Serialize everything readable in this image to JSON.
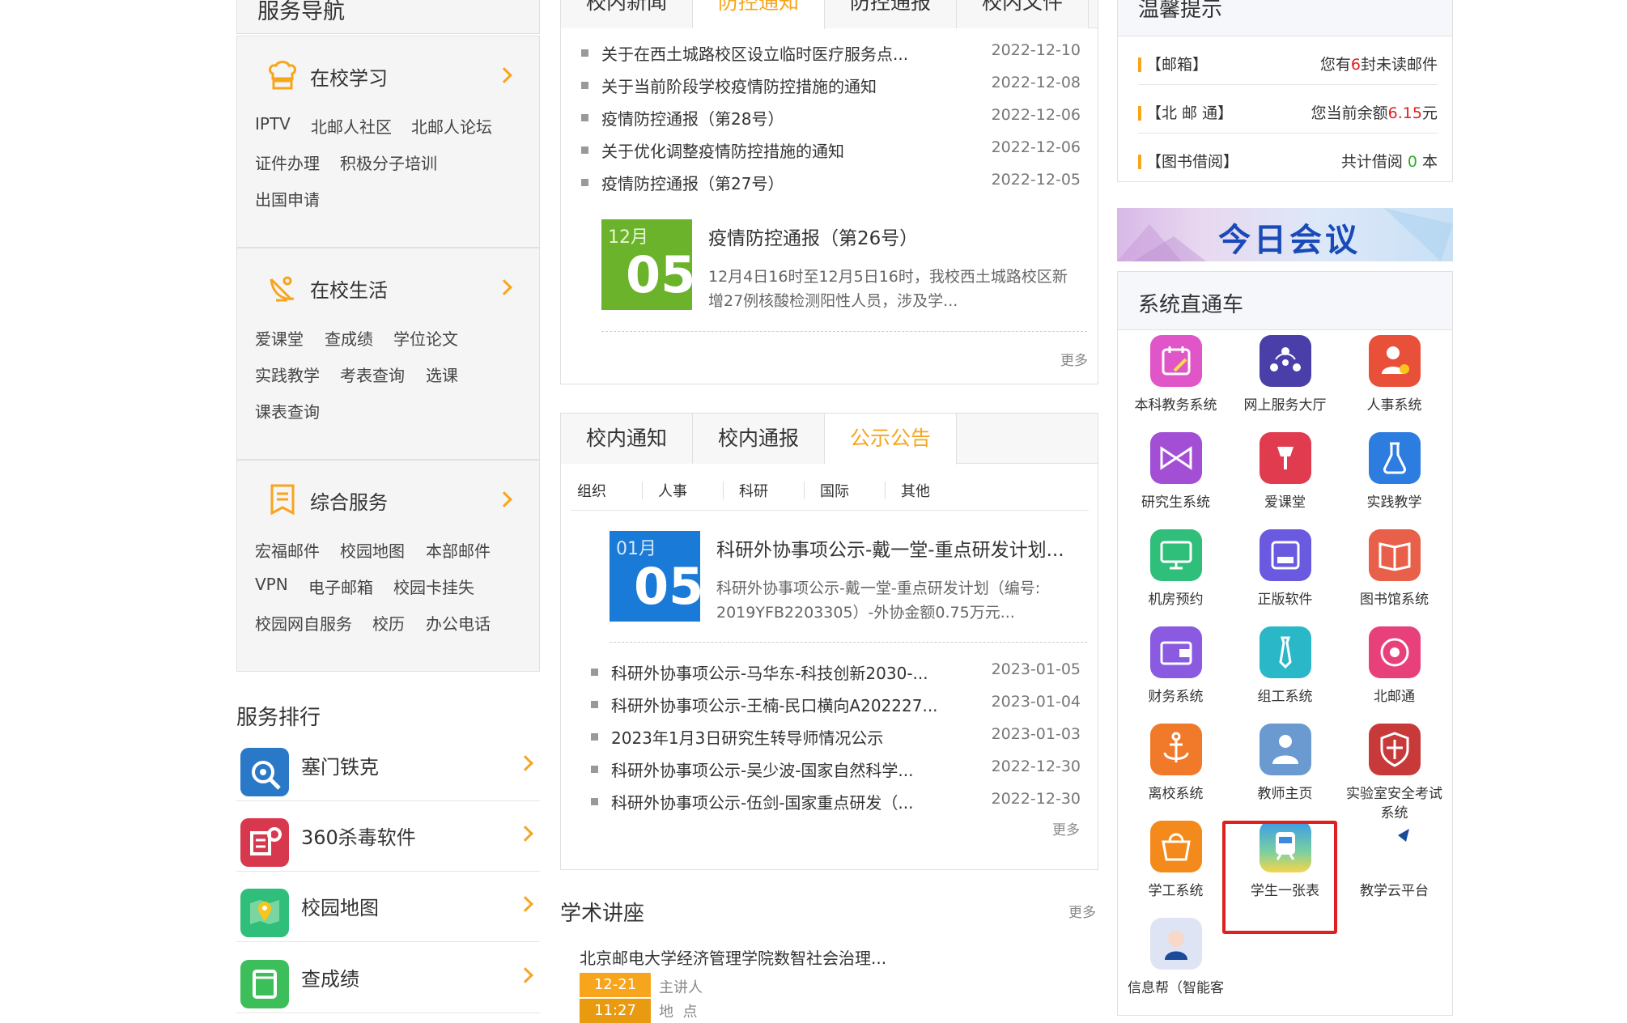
{
  "service_nav": {
    "title": "服务导航",
    "sections": [
      {
        "title": "在校学习",
        "links": [
          "IPTV",
          "北邮人社区",
          "北邮人论坛",
          "证件办理",
          "积极分子培训",
          "出国申请"
        ]
      },
      {
        "title": "在校生活",
        "links": [
          "爱课堂",
          "查成绩",
          "学位论文",
          "实践教学",
          "考表查询",
          "选课",
          "课表查询"
        ]
      },
      {
        "title": "综合服务",
        "links": [
          "宏福邮件",
          "校园地图",
          "本部邮件",
          "VPN",
          "电子邮箱",
          "校园卡挂失",
          "校园网自服务",
          "校历",
          "办公电话"
        ]
      }
    ]
  },
  "service_rank": {
    "title": "服务排行",
    "items": [
      "塞门铁克",
      "360杀毒软件",
      "校园地图",
      "查成绩"
    ]
  },
  "news_panel": {
    "tabs": [
      "校内新闻",
      "防控通知",
      "防控通报",
      "校内文件"
    ],
    "active_tab": 1,
    "items": [
      {
        "title": "关于在西土城路校区设立临时医疗服务点...",
        "date": "2022-12-10"
      },
      {
        "title": "关于当前阶段学校疫情防控措施的通知",
        "date": "2022-12-08"
      },
      {
        "title": "疫情防控通报（第28号）",
        "date": "2022-12-06"
      },
      {
        "title": "关于优化调整疫情防控措施的通知",
        "date": "2022-12-06"
      },
      {
        "title": "疫情防控通报（第27号）",
        "date": "2022-12-05"
      }
    ],
    "featured": {
      "month": "12月",
      "day": "05",
      "title": "疫情防控通报（第26号）",
      "summary_line1": "12月4日16时至12月5日16时，我校西土城路校区新",
      "summary_line2": "增27例核酸检测阳性人员，涉及学..."
    },
    "more": "更多"
  },
  "notice_panel": {
    "tabs": [
      "校内通知",
      "校内通报",
      "公示公告"
    ],
    "active_tab": 2,
    "subtabs": [
      "组织",
      "人事",
      "科研",
      "国际",
      "其他"
    ],
    "featured": {
      "month": "01月",
      "day": "05",
      "title": "科研外协事项公示-戴一堂-重点研发计划...",
      "summary_line1": "科研外协事项公示-戴一堂-重点研发计划（编号:",
      "summary_line2": "2019YFB2203305）-外协金额0.75万元..."
    },
    "items": [
      {
        "title": "科研外协事项公示-马华东-科技创新2030-...",
        "date": "2023-01-05"
      },
      {
        "title": "科研外协事项公示-王楠-民口横向A202227...",
        "date": "2023-01-04"
      },
      {
        "title": "2023年1月3日研究生转导师情况公示",
        "date": "2023-01-03"
      },
      {
        "title": "科研外协事项公示-吴少波-国家自然科学...",
        "date": "2022-12-30"
      },
      {
        "title": "科研外协事项公示-伍剑-国家重点研发（...",
        "date": "2022-12-30"
      }
    ],
    "more": "更多"
  },
  "lecture": {
    "title": "学术讲座",
    "more": "更多",
    "item_title": "北京邮电大学经济管理学院数智社会治理...",
    "date1": "12-21",
    "date2": "11:27",
    "speaker_label": "主讲人",
    "place_label": "地  点"
  },
  "tips": {
    "title": "温馨提示",
    "mail_label": "【邮箱】",
    "mail_pre": "您有",
    "mail_count": "6",
    "mail_post": "封未读邮件",
    "pass_label": "【北 邮 通】",
    "pass_pre": "您当前余额",
    "pass_amount": "6.15",
    "pass_post": "元",
    "lib_label": "【图书借阅】",
    "lib_pre": "共计借阅 ",
    "lib_count": "0",
    "lib_post": " 本"
  },
  "meeting_banner": "今日会议",
  "systems": {
    "title": "系统直通车",
    "items": [
      {
        "label": "本科教务系统",
        "icon": "calendar-edit-icon",
        "color": "#e056c8"
      },
      {
        "label": "网上服务大厅",
        "icon": "people-network-icon",
        "color": "#4a3fa8"
      },
      {
        "label": "人事系统",
        "icon": "person-phone-icon",
        "color": "#e8503a"
      },
      {
        "label": "研究生系统",
        "icon": "bowtie-icon",
        "color": "#a24fd6"
      },
      {
        "label": "爱课堂",
        "icon": "microphone-icon",
        "color": "#e03b4e"
      },
      {
        "label": "实践教学",
        "icon": "flask-icon",
        "color": "#2d7de0"
      },
      {
        "label": "机房预约",
        "icon": "monitor-icon",
        "color": "#2fbf7a"
      },
      {
        "label": "正版软件",
        "icon": "disk-icon",
        "color": "#6a5ae0"
      },
      {
        "label": "图书馆系统",
        "icon": "book-icon",
        "color": "#e8604a"
      },
      {
        "label": "财务系统",
        "icon": "wallet-icon",
        "color": "#8a5ae0"
      },
      {
        "label": "组工系统",
        "icon": "tie-icon",
        "color": "#2ab8c8"
      },
      {
        "label": "北邮通",
        "icon": "card-icon",
        "color": "#e8407a"
      },
      {
        "label": "离校系统",
        "icon": "anchor-icon",
        "color": "#f07a2a"
      },
      {
        "label": "教师主页",
        "icon": "teacher-icon",
        "color": "#6a9ad0"
      },
      {
        "label": "实验室安全考试",
        "label2": "系统",
        "icon": "shield-icon",
        "color": "#c83a3a"
      },
      {
        "label": "学工系统",
        "icon": "bag-icon",
        "color": "#f58a1c"
      },
      {
        "label": "学生一张表",
        "icon": "train-icon",
        "color": "#3a8ae0"
      },
      {
        "label": "教学云平台",
        "icon": "cloud-book-icon",
        "color": "#2a6ab8"
      },
      {
        "label": "信息帮（智能客",
        "icon": "service-avatar-icon",
        "color": "#6a6ab0"
      }
    ]
  }
}
